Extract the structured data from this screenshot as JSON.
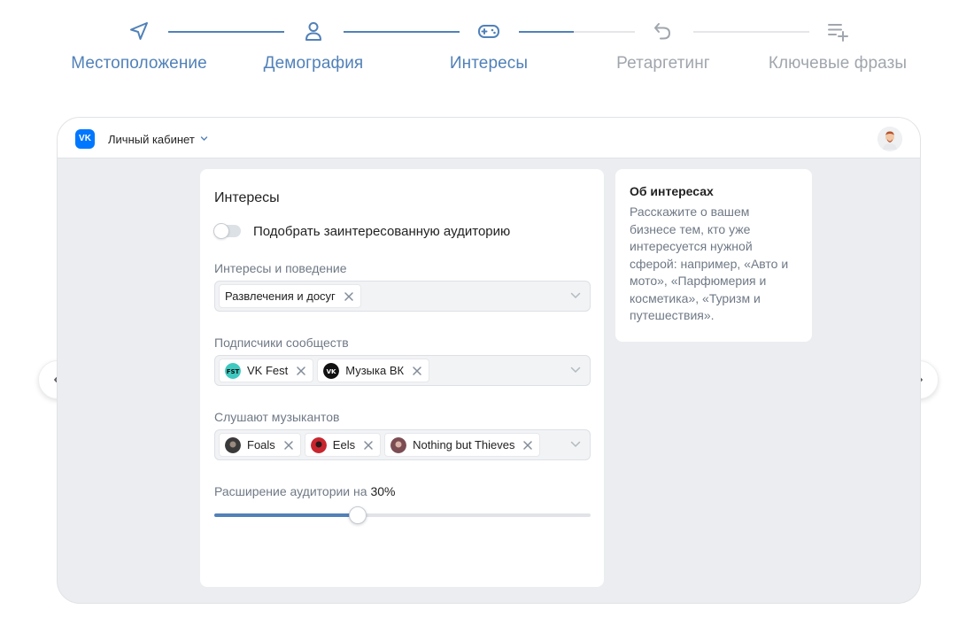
{
  "stepper": {
    "steps": [
      {
        "label": "Местоположение",
        "icon": "navigation-arrow-icon",
        "state": "done"
      },
      {
        "label": "Демография",
        "icon": "user-icon",
        "state": "done"
      },
      {
        "label": "Интересы",
        "icon": "gamepad-icon",
        "state": "current"
      },
      {
        "label": "Ретаргетинг",
        "icon": "undo-arrow-icon",
        "state": "todo"
      },
      {
        "label": "Ключевые фразы",
        "icon": "list-add-icon",
        "state": "todo"
      }
    ],
    "accent_color": "#5181b8",
    "inactive_color": "#a0a6ad"
  },
  "topbar": {
    "logo": "VK",
    "account_label": "Личный кабинет"
  },
  "interests": {
    "title": "Интересы",
    "toggle_label": "Подобрать заинтересованную аудиторию",
    "toggle_on": false,
    "interests_label": "Интересы и поведение",
    "interests_chips": [
      {
        "label": "Развлечения и досуг"
      }
    ],
    "communities_label": "Подписчики сообществ",
    "communities_chips": [
      {
        "label": "VK Fest",
        "avatar_color": "#3fc9c0"
      },
      {
        "label": "Музыка ВК",
        "avatar_color": "#111111"
      }
    ],
    "musicians_label": "Слушают музыкантов",
    "musicians_chips": [
      {
        "label": "Foals",
        "avatar_color": "#3a3a3a"
      },
      {
        "label": "Eels",
        "avatar_color": "#c8262e"
      },
      {
        "label": "Nothing but Thieves",
        "avatar_color": "#7b4d52"
      }
    ],
    "expansion_label": "Расширение аудитории на",
    "expansion_value": "30%",
    "expansion_fraction": 0.38
  },
  "info": {
    "title": "Об интересах",
    "text": "Расскажите о вашем бизнесе тем, кто уже интересуется нужной сферой: например, «Авто и мото», «Парфюмерия и косметика», «Туризм и путешествия»."
  }
}
